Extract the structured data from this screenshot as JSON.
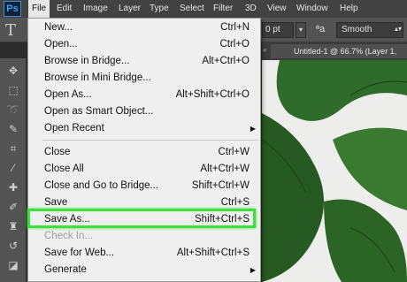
{
  "app": {
    "logo": "Ps"
  },
  "menubar": {
    "items": [
      {
        "label": "File",
        "active": true
      },
      {
        "label": "Edit"
      },
      {
        "label": "Image"
      },
      {
        "label": "Layer"
      },
      {
        "label": "Type"
      },
      {
        "label": "Select"
      },
      {
        "label": "Filter"
      },
      {
        "label": "3D"
      },
      {
        "label": "View"
      },
      {
        "label": "Window"
      },
      {
        "label": "Help"
      }
    ]
  },
  "options_bar": {
    "tool_glyph": "T",
    "font_size": "0 pt",
    "antialias_icon": "ªa",
    "antialias": "Smooth"
  },
  "document_tab": {
    "title": "Untitled-1 @ 66.7% (Layer 1,"
  },
  "file_menu": {
    "items": [
      {
        "label": "New...",
        "shortcut": "Ctrl+N"
      },
      {
        "label": "Open...",
        "shortcut": "Ctrl+O"
      },
      {
        "label": "Browse in Bridge...",
        "shortcut": "Alt+Ctrl+O"
      },
      {
        "label": "Browse in Mini Bridge...",
        "shortcut": ""
      },
      {
        "label": "Open As...",
        "shortcut": "Alt+Shift+Ctrl+O"
      },
      {
        "label": "Open as Smart Object...",
        "shortcut": ""
      },
      {
        "label": "Open Recent",
        "shortcut": "",
        "submenu": true
      },
      {
        "label": "Close",
        "shortcut": "Ctrl+W"
      },
      {
        "label": "Close All",
        "shortcut": "Alt+Ctrl+W"
      },
      {
        "label": "Close and Go to Bridge...",
        "shortcut": "Shift+Ctrl+W"
      },
      {
        "label": "Save",
        "shortcut": "Ctrl+S"
      },
      {
        "label": "Save As...",
        "shortcut": "Shift+Ctrl+S",
        "highlighted": true
      },
      {
        "label": "Check In...",
        "shortcut": "",
        "disabled": true
      },
      {
        "label": "Save for Web...",
        "shortcut": "Alt+Shift+Ctrl+S"
      },
      {
        "label": "Generate",
        "shortcut": "",
        "submenu": true
      }
    ]
  },
  "colors": {
    "highlight": "#3de03d",
    "menu_bg": "#efefef",
    "app_bg": "#2b2b2b"
  }
}
